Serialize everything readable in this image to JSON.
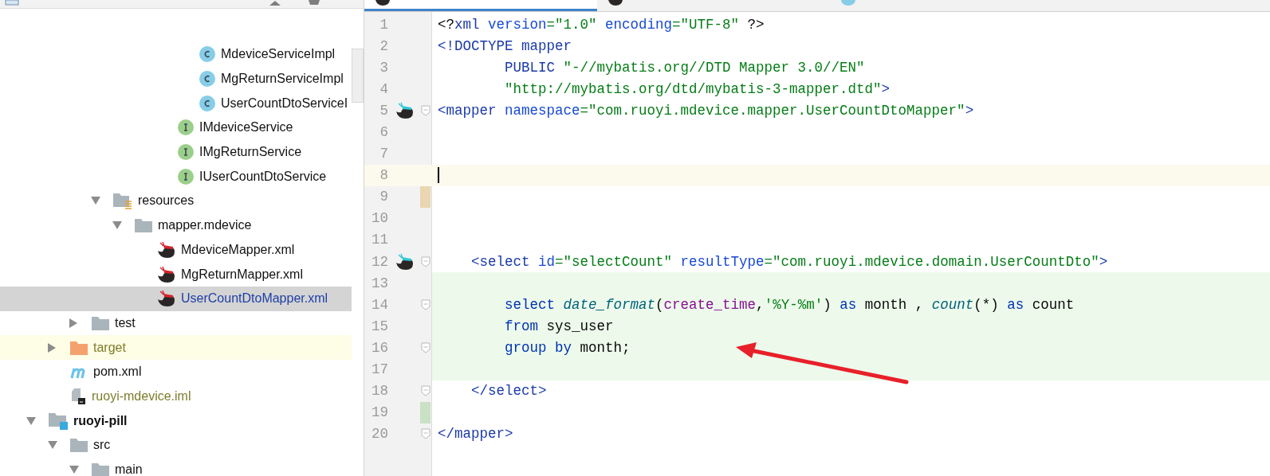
{
  "project_panel": {
    "tree": [
      {
        "children": [
          {
            "children": [
              {
                "children": [
                  {
                    "children": [
                      {
                        "children": [
                          {
                            "children": [
                              {
                                "children": [
                                  {
                                    "label": "MdeviceServiceImpl",
                                    "kind": "class",
                                    "selected": false
                                  },
                                  {
                                    "label": "MgReturnServiceImpl",
                                    "kind": "class",
                                    "selected": false
                                  },
                                  {
                                    "label": "UserCountDtoServiceI",
                                    "kind": "class",
                                    "selected": false
                                  }
                                ]
                              },
                              {
                                "label": "IMdeviceService",
                                "kind": "interface",
                                "selected": false
                              },
                              {
                                "label": "IMgReturnService",
                                "kind": "interface",
                                "selected": false
                              },
                              {
                                "label": "IUserCountDtoService",
                                "kind": "interface",
                                "selected": false
                              }
                            ]
                          }
                        ]
                      }
                    ]
                  },
                  {
                    "label": "resources",
                    "kind": "resources",
                    "expanded": true,
                    "selected": false,
                    "children": [
                      {
                        "label": "mapper.mdevice",
                        "kind": "folder",
                        "expanded": true,
                        "selected": false,
                        "children": [
                          {
                            "label": "MdeviceMapper.xml",
                            "kind": "mapper",
                            "selected": false
                          },
                          {
                            "label": "MgReturnMapper.xml",
                            "kind": "mapper",
                            "selected": false
                          },
                          {
                            "label": "UserCountDtoMapper.xml",
                            "kind": "mapper",
                            "selected": true
                          }
                        ]
                      }
                    ]
                  }
                ]
              },
              {
                "label": "test",
                "kind": "folder",
                "expanded": false,
                "selected": false
              }
            ]
          },
          {
            "label": "target",
            "kind": "folder",
            "expanded": false,
            "selected": false,
            "excluded": true
          },
          {
            "label": "pom.xml",
            "kind": "maven",
            "selected": false
          },
          {
            "label": "ruoyi-mdevice.iml",
            "kind": "module-file",
            "selected": false,
            "ignored": true
          }
        ]
      },
      {
        "label": "ruoyi-pill",
        "kind": "module",
        "expanded": true,
        "selected": false,
        "children": [
          {
            "label": "src",
            "kind": "folder",
            "expanded": true,
            "selected": false,
            "children": [
              {
                "label": "main",
                "kind": "folder",
                "expanded": true,
                "selected": false
              }
            ]
          }
        ]
      }
    ]
  },
  "editor_tabs": [
    {
      "kind": "mapper",
      "selected": true
    },
    {
      "kind": "mapper",
      "selected": false
    },
    {
      "kind": "class",
      "selected": false
    }
  ],
  "editor": {
    "lines": [
      {
        "number": "1",
        "tokens": [
          {
            "kind": "plain",
            "text": "<?"
          },
          {
            "kind": "tag",
            "text": "xml "
          },
          {
            "kind": "attr",
            "text": "version"
          },
          {
            "kind": "str",
            "text": "=\"1.0\" "
          },
          {
            "kind": "attr",
            "text": "encoding"
          },
          {
            "kind": "str",
            "text": "=\"UTF-8\" "
          },
          {
            "kind": "plain",
            "text": "?>"
          }
        ]
      },
      {
        "number": "2",
        "tokens": [
          {
            "kind": "tag",
            "text": "<!DOCTYPE mapper"
          }
        ]
      },
      {
        "number": "3",
        "tokens": [
          {
            "kind": "tag",
            "text": "        PUBLIC "
          },
          {
            "kind": "str",
            "text": "\"-//mybatis.org//DTD Mapper 3.0//EN\""
          }
        ]
      },
      {
        "number": "4",
        "tokens": [
          {
            "kind": "str",
            "text": "        \"http://mybatis.org/dtd/mybatis-3-mapper.dtd\""
          },
          {
            "kind": "tag",
            "text": ">"
          }
        ]
      },
      {
        "number": "5",
        "bird": true,
        "fold": true,
        "tokens": [
          {
            "kind": "tag",
            "text": "<mapper "
          },
          {
            "kind": "attr",
            "text": "namespace"
          },
          {
            "kind": "str",
            "text": "=\"com.ruoyi.mdevice.mapper.UserCountDtoMapper\""
          },
          {
            "kind": "tag",
            "text": ">"
          }
        ]
      },
      {
        "number": "6"
      },
      {
        "number": "7"
      },
      {
        "number": "8",
        "caret": true
      },
      {
        "number": "9",
        "modified": true
      },
      {
        "number": "10"
      },
      {
        "number": "11"
      },
      {
        "number": "12",
        "bird": true,
        "fold": true,
        "tokens": [
          {
            "kind": "tag",
            "text": "    <select "
          },
          {
            "kind": "attr",
            "text": "id"
          },
          {
            "kind": "str",
            "text": "=\"selectCount\" "
          },
          {
            "kind": "attr",
            "text": "resultType"
          },
          {
            "kind": "str",
            "text": "=\"com.ruoyi.mdevice.domain.UserCountDto\""
          },
          {
            "kind": "tag",
            "text": ">"
          }
        ]
      },
      {
        "number": "13",
        "injected": true
      },
      {
        "number": "14",
        "injected": true,
        "fold": true,
        "tokens": [
          {
            "kind": "kw",
            "text": "        select "
          },
          {
            "kind": "fn",
            "text": "date_format"
          },
          {
            "kind": "plain",
            "text": "("
          },
          {
            "kind": "col",
            "text": "create_time"
          },
          {
            "kind": "plain",
            "text": ","
          },
          {
            "kind": "str",
            "text": "'%Y-%m'"
          },
          {
            "kind": "plain",
            "text": ") "
          },
          {
            "kind": "kw",
            "text": "as "
          },
          {
            "kind": "plain",
            "text": "month , "
          },
          {
            "kind": "fn",
            "text": "count"
          },
          {
            "kind": "plain",
            "text": "(*) "
          },
          {
            "kind": "kw",
            "text": "as "
          },
          {
            "kind": "plain",
            "text": "count"
          }
        ]
      },
      {
        "number": "15",
        "injected": true,
        "tokens": [
          {
            "kind": "kw",
            "text": "        from "
          },
          {
            "kind": "plain",
            "text": "sys_user"
          }
        ]
      },
      {
        "number": "16",
        "injected": true,
        "fold": true,
        "tokens": [
          {
            "kind": "kw",
            "text": "        group by "
          },
          {
            "kind": "plain",
            "text": "month;"
          }
        ]
      },
      {
        "number": "17",
        "injected": true
      },
      {
        "number": "18",
        "fold": true,
        "tokens": [
          {
            "kind": "tag",
            "text": "    </select>"
          }
        ]
      },
      {
        "number": "19",
        "added": true
      },
      {
        "number": "20",
        "fold": true,
        "tokens": [
          {
            "kind": "tag",
            "text": "</mapper>"
          }
        ]
      }
    ]
  }
}
